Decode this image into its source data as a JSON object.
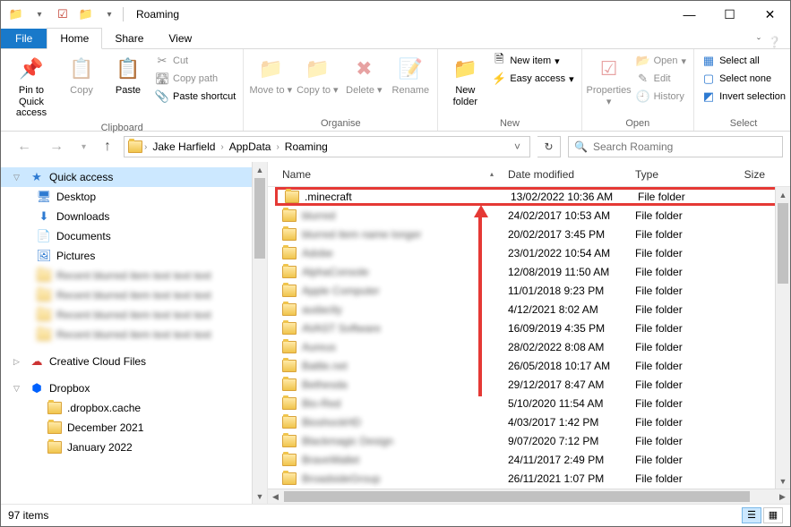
{
  "window": {
    "title": "Roaming"
  },
  "tabs": {
    "file": "File",
    "home": "Home",
    "share": "Share",
    "view": "View"
  },
  "ribbon": {
    "clipboard": {
      "label": "Clipboard",
      "pin": "Pin to Quick access",
      "copy": "Copy",
      "paste": "Paste",
      "cut": "Cut",
      "copypath": "Copy path",
      "shortcut": "Paste shortcut"
    },
    "organise": {
      "label": "Organise",
      "move": "Move to",
      "copy": "Copy to",
      "delete": "Delete",
      "rename": "Rename"
    },
    "new": {
      "label": "New",
      "folder": "New folder",
      "item": "New item",
      "easy": "Easy access"
    },
    "open": {
      "label": "Open",
      "properties": "Properties",
      "open": "Open",
      "edit": "Edit",
      "history": "History"
    },
    "select": {
      "label": "Select",
      "all": "Select all",
      "none": "Select none",
      "invert": "Invert selection"
    }
  },
  "breadcrumbs": [
    "Jake Harfield",
    "AppData",
    "Roaming"
  ],
  "search": {
    "placeholder": "Search Roaming"
  },
  "sidebar": {
    "quick": "Quick access",
    "items": [
      {
        "label": "Desktop",
        "icon": "🖥",
        "color": "#2e7ad1"
      },
      {
        "label": "Downloads",
        "icon": "⬇",
        "color": "#2e7ad1"
      },
      {
        "label": "Documents",
        "icon": "📄",
        "color": "#2e7ad1"
      },
      {
        "label": "Pictures",
        "icon": "🖼",
        "color": "#2e7ad1"
      }
    ],
    "ccf": "Creative Cloud Files",
    "dropbox": "Dropbox",
    "db_items": [
      ".dropbox.cache",
      "December 2021",
      "January 2022"
    ]
  },
  "columns": {
    "name": "Name",
    "date": "Date modified",
    "type": "Type",
    "size": "Size"
  },
  "files": [
    {
      "name": ".minecraft",
      "date": "13/02/2022 10:36 AM",
      "type": "File folder",
      "hl": true,
      "blur": false
    },
    {
      "name": "blurred",
      "date": "24/02/2017 10:53 AM",
      "type": "File folder",
      "blur": true
    },
    {
      "name": "blurred item name longer",
      "date": "20/02/2017 3:45 PM",
      "type": "File folder",
      "blur": true
    },
    {
      "name": "Adobe",
      "date": "23/01/2022 10:54 AM",
      "type": "File folder",
      "blur": true
    },
    {
      "name": "AlphaConsole",
      "date": "12/08/2019 11:50 AM",
      "type": "File folder",
      "blur": true
    },
    {
      "name": "Apple Computer",
      "date": "11/01/2018 9:23 PM",
      "type": "File folder",
      "blur": true
    },
    {
      "name": "audacity",
      "date": "4/12/2021 8:02 AM",
      "type": "File folder",
      "blur": true
    },
    {
      "name": "AVAST Software",
      "date": "16/09/2019 4:35 PM",
      "type": "File folder",
      "blur": true
    },
    {
      "name": "Aureus",
      "date": "28/02/2022 8:08 AM",
      "type": "File folder",
      "blur": true
    },
    {
      "name": "Battle.net",
      "date": "26/05/2018 10:17 AM",
      "type": "File folder",
      "blur": true
    },
    {
      "name": "Bethesda",
      "date": "29/12/2017 8:47 AM",
      "type": "File folder",
      "blur": true
    },
    {
      "name": "Bio-Red",
      "date": "5/10/2020 11:54 AM",
      "type": "File folder",
      "blur": true
    },
    {
      "name": "BioshockHD",
      "date": "4/03/2017 1:42 PM",
      "type": "File folder",
      "blur": true
    },
    {
      "name": "Blackmagic Design",
      "date": "9/07/2020 7:12 PM",
      "type": "File folder",
      "blur": true
    },
    {
      "name": "BraveWallet",
      "date": "24/11/2017 2:49 PM",
      "type": "File folder",
      "blur": true
    },
    {
      "name": "BroadsideGroup",
      "date": "26/11/2021 1:07 PM",
      "type": "File folder",
      "blur": true
    }
  ],
  "status": {
    "count": "97 items"
  }
}
